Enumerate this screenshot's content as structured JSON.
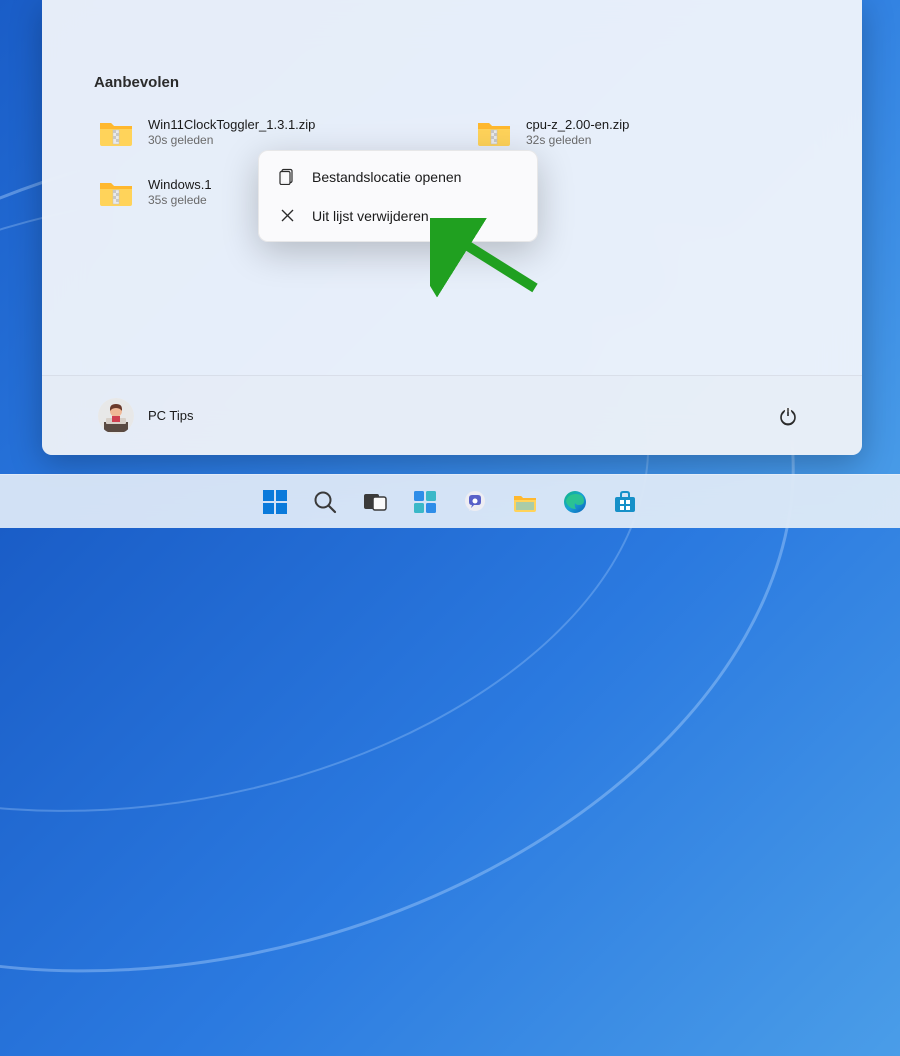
{
  "start": {
    "section_title": "Aanbevolen",
    "items": [
      {
        "name": "Win11ClockToggler_1.3.1.zip",
        "time": "30s geleden"
      },
      {
        "name": "cpu-z_2.00-en.zip",
        "time": "32s geleden"
      },
      {
        "name": "Windows.1",
        "time": "35s gelede"
      }
    ],
    "user": "PC Tips"
  },
  "context_menu": {
    "open_location": "Bestandslocatie openen",
    "remove": "Uit lijst verwijderen"
  },
  "taskbar_icons": [
    "start",
    "search",
    "task-view",
    "widgets",
    "chat",
    "file-explorer",
    "edge",
    "store"
  ],
  "colors": {
    "arrow": "#20a020"
  }
}
